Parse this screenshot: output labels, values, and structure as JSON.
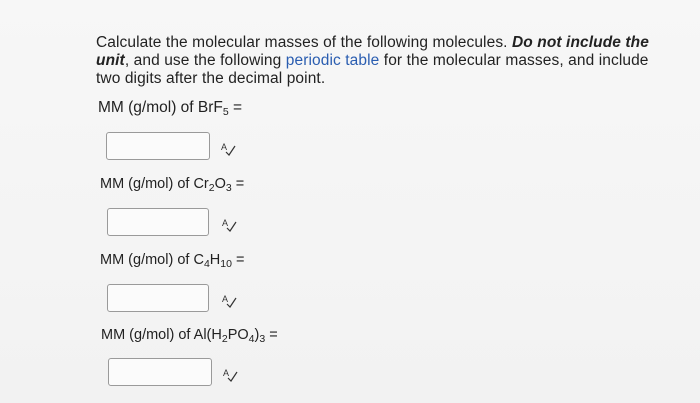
{
  "instructions": {
    "part1": "Calculate the molecular masses of the following molecules. ",
    "emphasis1": "Do not include the unit",
    "part2": ", and use the following ",
    "link_text": "periodic table",
    "part3": " for the molecular masses, and include two digits after the decimal point."
  },
  "questions": [
    {
      "prefix": "MM (g/mol) of ",
      "formula": [
        [
          "Br",
          ""
        ],
        [
          "F",
          "5"
        ]
      ],
      "suffix": " =",
      "value": "",
      "placeholder": ""
    },
    {
      "prefix": "MM (g/mol) of ",
      "formula": [
        [
          "Cr",
          "2"
        ],
        [
          "O",
          "3"
        ]
      ],
      "suffix": " =",
      "value": "",
      "placeholder": ""
    },
    {
      "prefix": "MM (g/mol) of ",
      "formula": [
        [
          "C",
          "4"
        ],
        [
          "H",
          "10"
        ]
      ],
      "suffix": " =",
      "value": "",
      "placeholder": ""
    },
    {
      "prefix": "MM (g/mol) of ",
      "formula": [
        [
          "Al(H",
          "2"
        ],
        [
          "PO",
          "4"
        ],
        [
          ")",
          "3"
        ]
      ],
      "suffix": " =",
      "value": "",
      "placeholder": ""
    }
  ],
  "icons": {
    "spellcheck": "spellcheck-icon"
  },
  "colors": {
    "link": "#2a5db0",
    "background": "#f4f4f4"
  }
}
